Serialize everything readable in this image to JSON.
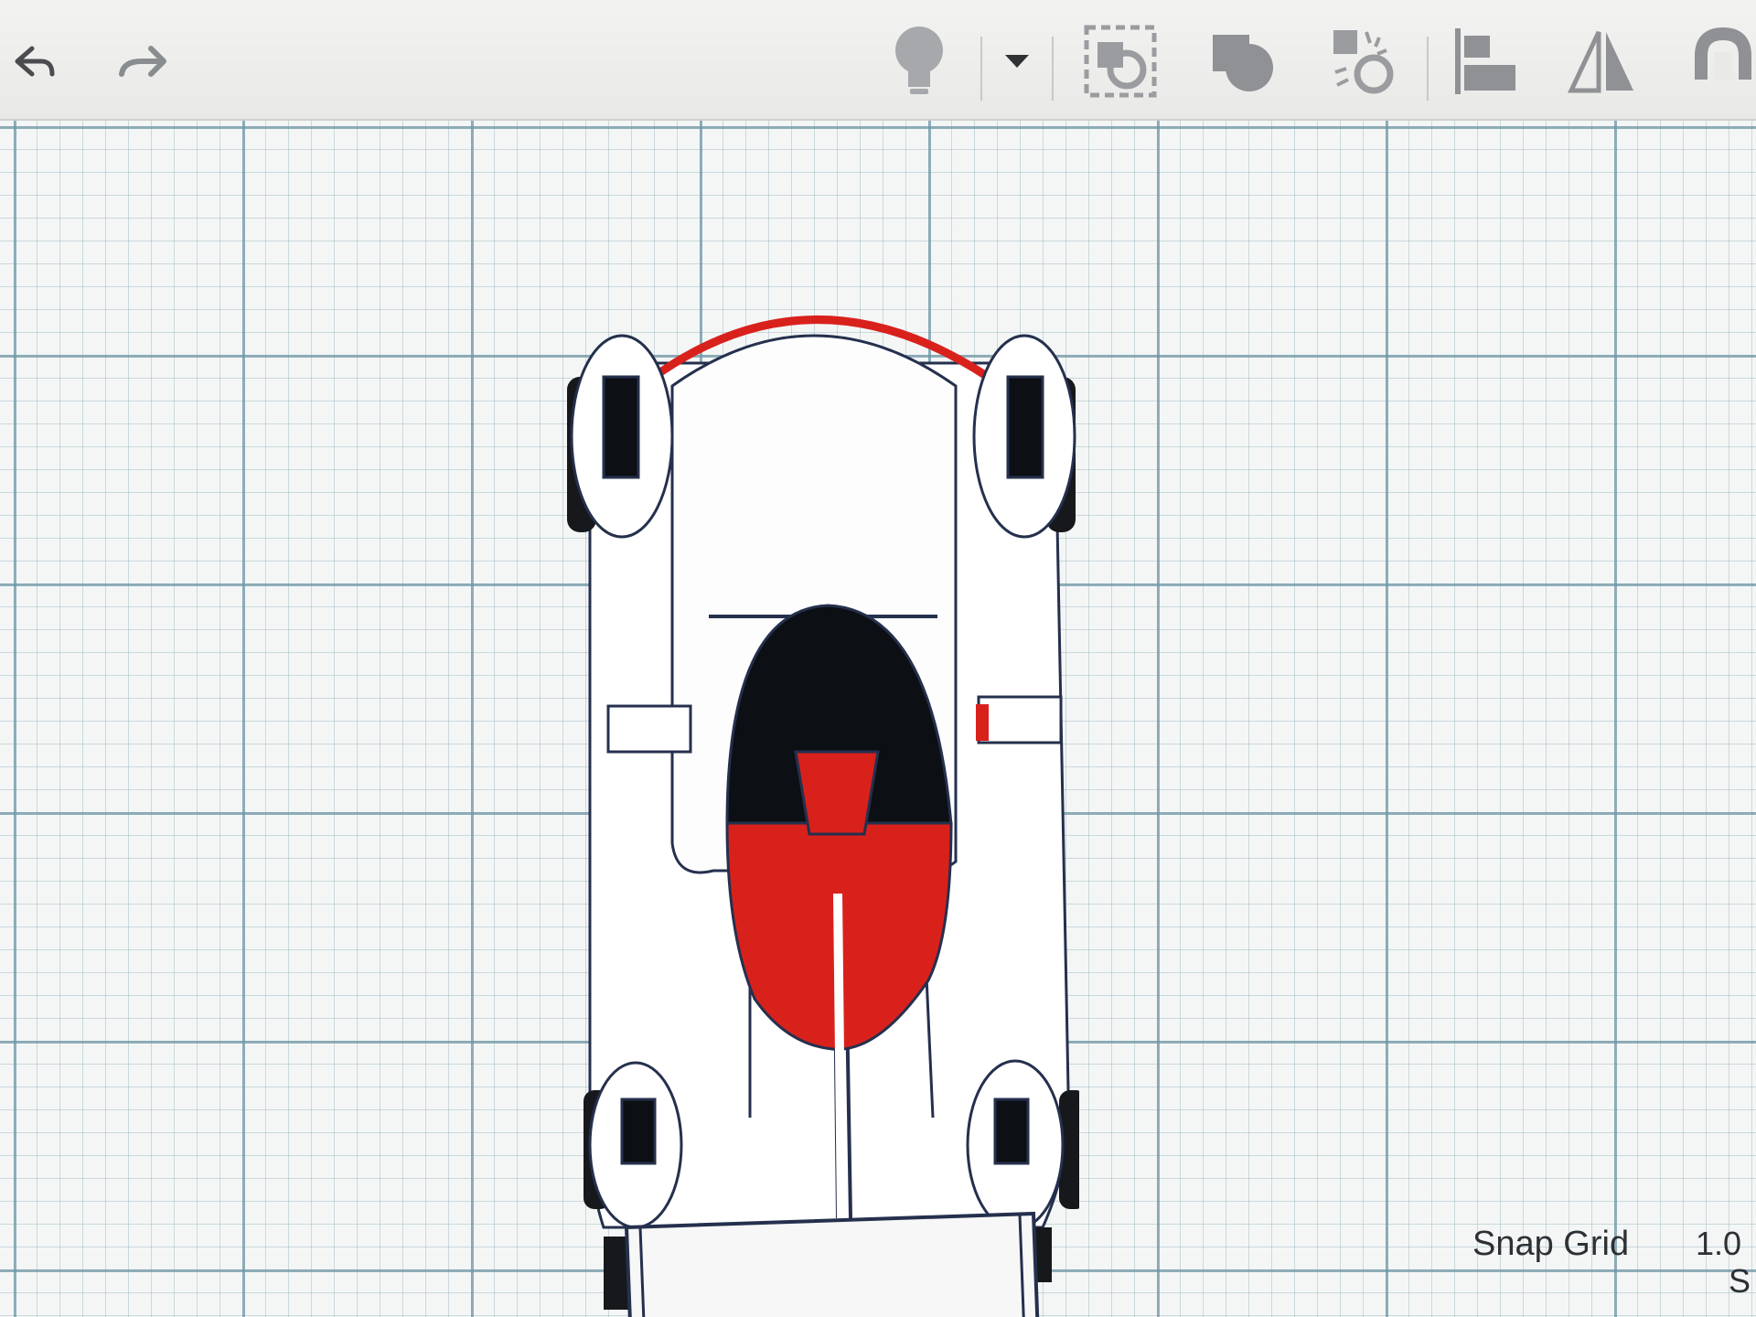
{
  "toolbar": {
    "buttons": [
      {
        "name": "undo",
        "icon": "undo-arrow-icon"
      },
      {
        "name": "redo",
        "icon": "redo-arrow-icon"
      },
      {
        "name": "light",
        "icon": "lightbulb-icon"
      },
      {
        "name": "light-dropdown",
        "icon": "caret-down-icon"
      },
      {
        "name": "group-selection",
        "icon": "group-bracket-icon"
      },
      {
        "name": "group",
        "icon": "group-shapes-icon"
      },
      {
        "name": "ungroup",
        "icon": "ungroup-icon"
      },
      {
        "name": "align",
        "icon": "align-icon"
      },
      {
        "name": "mirror",
        "icon": "mirror-icon"
      },
      {
        "name": "magnet",
        "icon": "magnet-icon"
      }
    ]
  },
  "workplane": {
    "corner_label": "S",
    "snap_grid": {
      "label": "Snap Grid",
      "value": "1.0"
    }
  },
  "colors": {
    "body": "#ffffff",
    "accent_red": "#d9211c",
    "dark": "#0c0f14",
    "outline": "#25304d"
  }
}
